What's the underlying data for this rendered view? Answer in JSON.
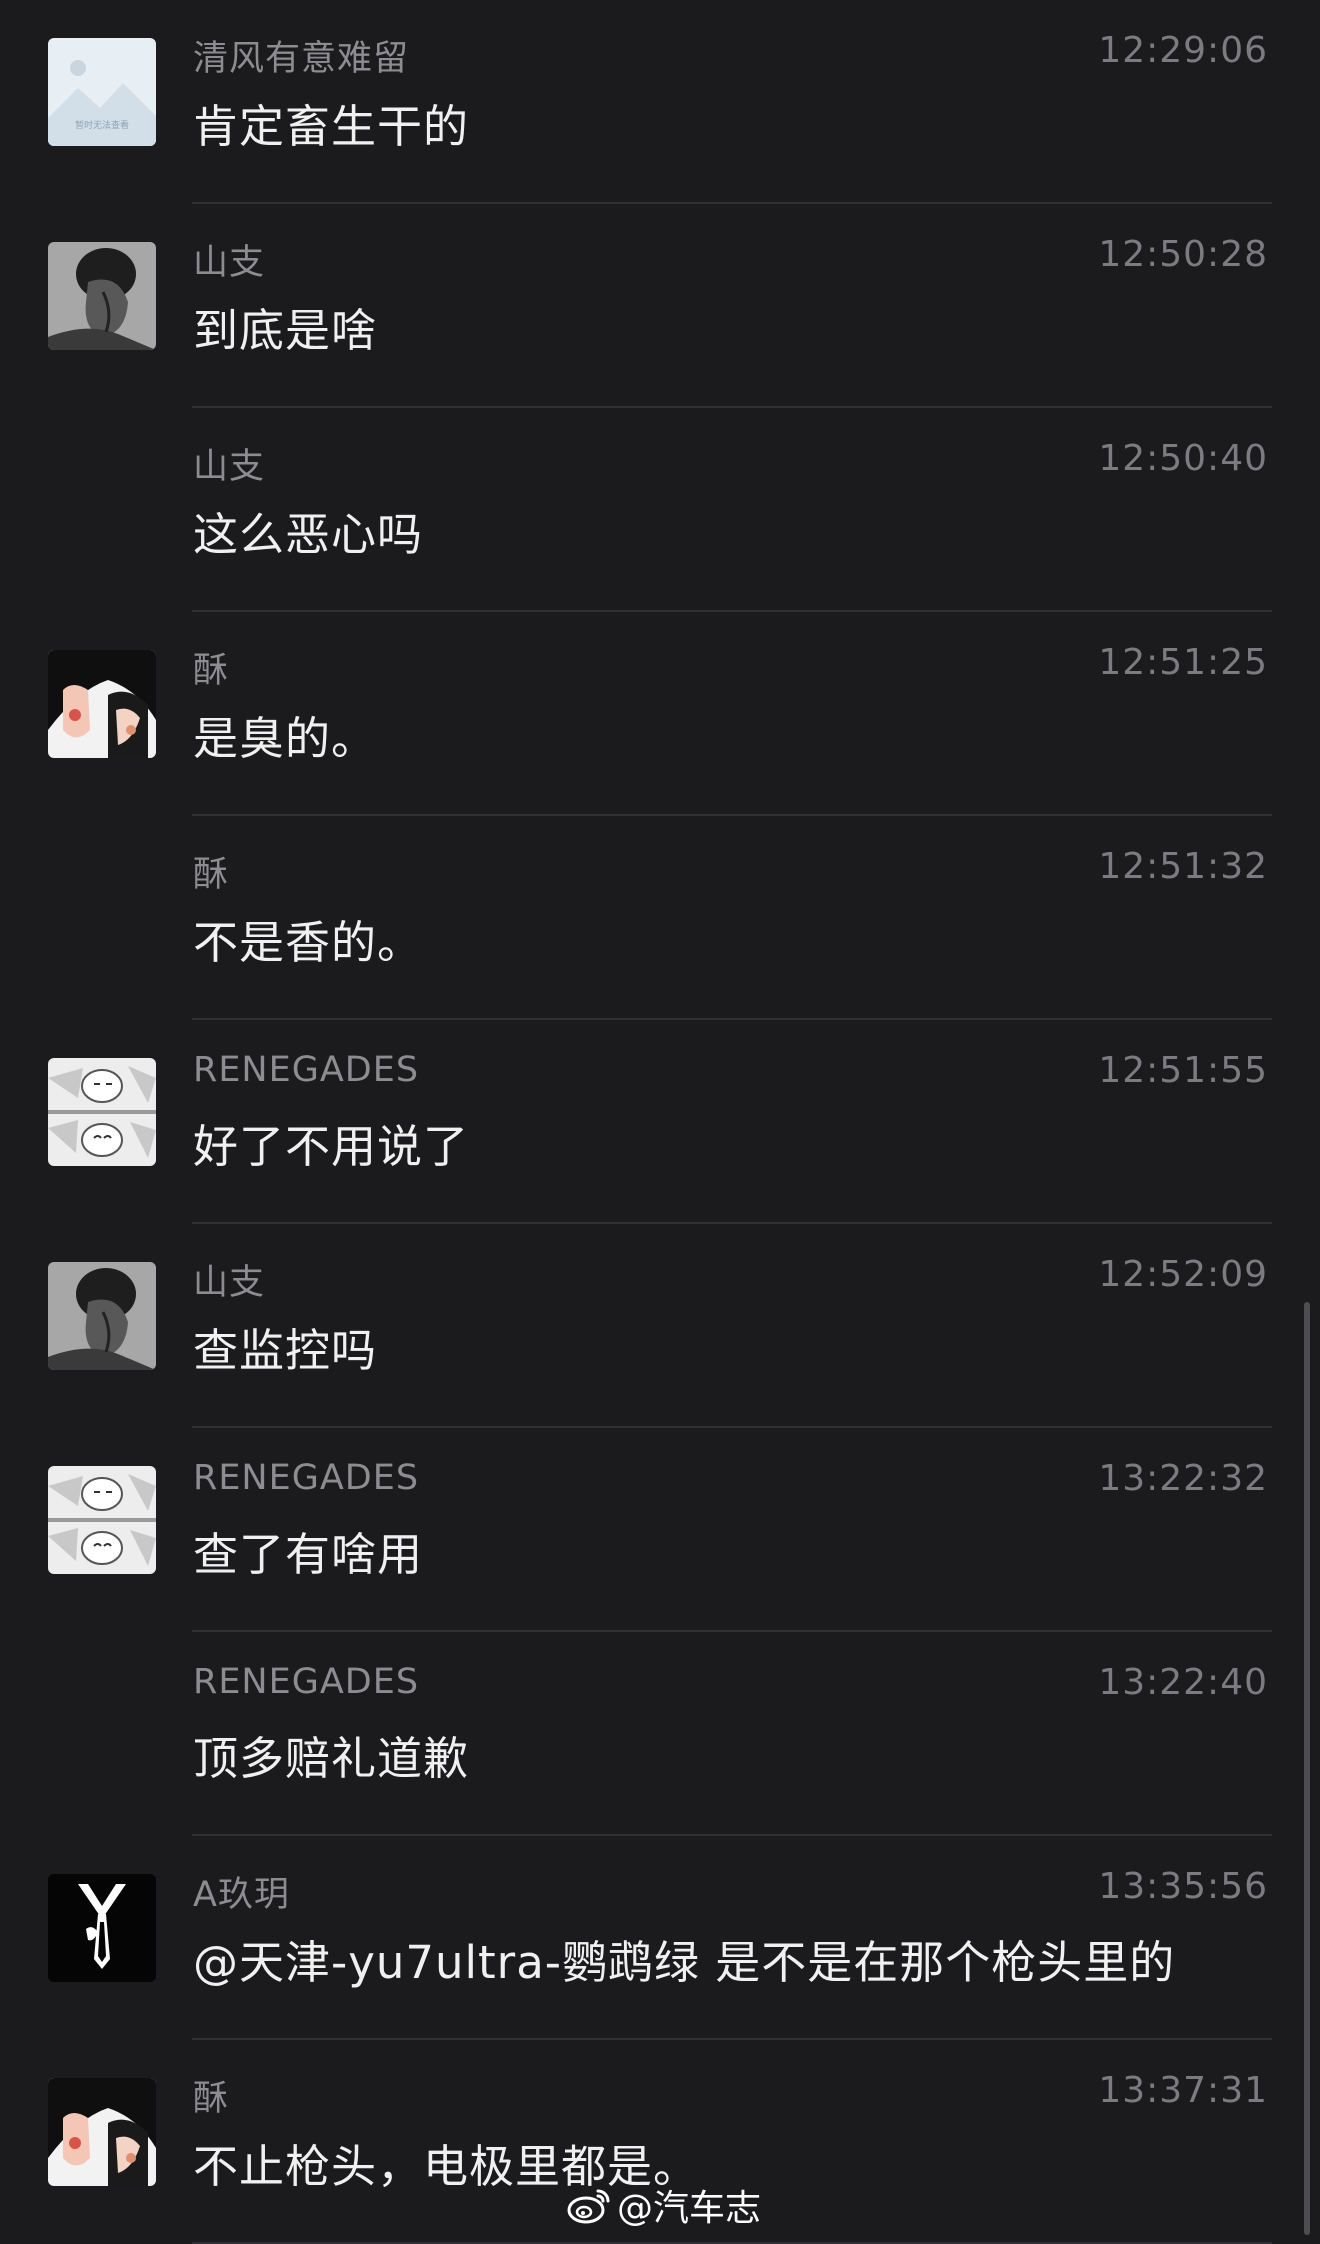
{
  "messages": [
    {
      "avatar": "placeholder-image",
      "avatar_text": "暂时无法查看",
      "sender": "清风有意难留",
      "time": "12:29:06",
      "text": "肯定畜生干的"
    },
    {
      "avatar": "man-bw",
      "sender": "山支",
      "time": "12:50:28",
      "text": "到底是啥"
    },
    {
      "avatar": "",
      "sender": "山支",
      "time": "12:50:40",
      "text": "这么恶心吗"
    },
    {
      "avatar": "anime-girl",
      "sender": "酥",
      "time": "12:51:25",
      "text": "是臭的。"
    },
    {
      "avatar": "",
      "sender": "酥",
      "time": "12:51:32",
      "text": "不是香的。"
    },
    {
      "avatar": "cartoon-panels",
      "sender": "RENEGADES",
      "time": "12:51:55",
      "text": "好了不用说了"
    },
    {
      "avatar": "man-bw",
      "sender": "山支",
      "time": "12:52:09",
      "text": "查监控吗"
    },
    {
      "avatar": "cartoon-panels",
      "sender": "RENEGADES",
      "time": "13:22:32",
      "text": "查了有啥用"
    },
    {
      "avatar": "",
      "sender": "RENEGADES",
      "time": "13:22:40",
      "text": "顶多赔礼道歉"
    },
    {
      "avatar": "suit-tie",
      "sender": "A玖玥",
      "time": "13:35:56",
      "text": "@天津-yu7ultra-鹦鹉绿 是不是在那个枪头里的"
    },
    {
      "avatar": "anime-girl",
      "sender": "酥",
      "time": "13:37:31",
      "text": "不止枪头，电极里都是。"
    }
  ],
  "watermark": {
    "text": "@汽车志",
    "icon": "weibo-icon"
  },
  "colors": {
    "background": "#1b1b1d",
    "divider": "#303034",
    "sender": "#8d8d91",
    "time": "#7b7b80",
    "text": "#f0f0f0"
  }
}
